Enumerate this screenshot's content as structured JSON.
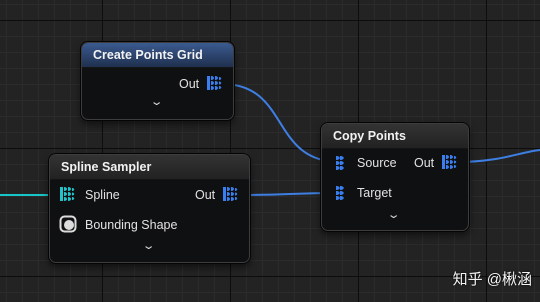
{
  "nodes": {
    "create_points_grid": {
      "title": "Create Points Grid",
      "out_label": "Out"
    },
    "spline_sampler": {
      "title": "Spline Sampler",
      "spline_label": "Spline",
      "out_label": "Out",
      "bounding_label": "Bounding Shape"
    },
    "copy_points": {
      "title": "Copy Points",
      "source_label": "Source",
      "target_label": "Target",
      "out_label": "Out"
    }
  },
  "expand_glyph": "⌄",
  "watermark": "知乎 @楸涵",
  "colors": {
    "wire_blue": "#3e7fe3",
    "wire_cyan": "#18c6c9",
    "header_blue": "#3b5a8f",
    "pin_blue": "#3a7ff0",
    "pin_cyan": "#22c4cc"
  }
}
